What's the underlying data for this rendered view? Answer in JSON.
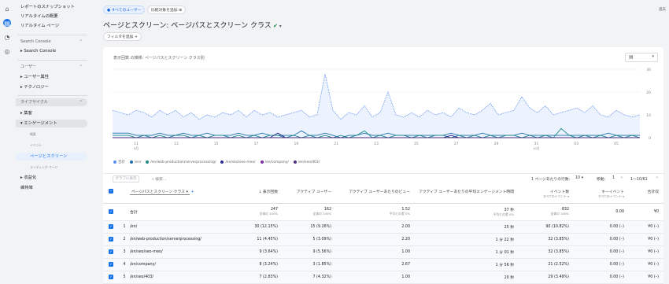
{
  "rail": {
    "icons": [
      "home-icon",
      "reports-icon",
      "explore-icon",
      "advertising-icon"
    ]
  },
  "sidebar": {
    "items": [
      {
        "label": "レポートのスナップショット"
      },
      {
        "label": "リアルタイムの概要"
      },
      {
        "label": "リアルタイム ページ"
      },
      {
        "label": "Search Console"
      },
      {
        "label": "Search Console"
      },
      {
        "label": "ユーザー"
      },
      {
        "label": "ユーザー属性"
      },
      {
        "label": "テクノロジー"
      },
      {
        "label": "ライフサイクル"
      },
      {
        "label": "集客"
      },
      {
        "label": "エンゲージメント"
      },
      {
        "label": "概要"
      },
      {
        "label": "イベント"
      },
      {
        "label": "ページとスクリーン"
      },
      {
        "label": "ランディング ページ"
      },
      {
        "label": "収益化"
      },
      {
        "label": "維持率"
      }
    ]
  },
  "header": {
    "segment_chip": "すべてのユーザー",
    "compare_chip": "比較対象を追加",
    "corner_text": "過去",
    "title": "ページとスクリーン: ページパスとスクリーン クラス",
    "filter_chip": "フィルタを追加"
  },
  "chart": {
    "title": "表示回数 の推移: ページパスとスクリーン クラス別",
    "dropdown_icon": "chart-type-icon",
    "colors": {
      "total": "#5b8def",
      "en": "#1e6fb0",
      "serverprocessing": "#1d8a8a",
      "seomeo": "#2e2a8c",
      "company": "#7a2e9f",
      "four03": "#4b2b7d"
    }
  },
  "chart_data": {
    "type": "line",
    "x_ticks": [
      "11",
      "13",
      "15",
      "17",
      "19",
      "21",
      "23",
      "25",
      "27",
      "29",
      "31",
      "03",
      "05"
    ],
    "x_sublabels": {
      "0": "9月",
      "10": "10\n月"
    },
    "ylim": [
      0,
      30
    ],
    "y_ticks": [
      0,
      10,
      20,
      30
    ],
    "series": [
      {
        "name": "合計",
        "values": [
          12,
          11,
          10,
          12,
          11,
          9,
          12,
          10,
          12,
          9,
          11,
          8,
          10,
          9,
          11,
          10,
          12,
          9,
          12,
          10,
          11,
          9,
          10,
          11,
          12,
          9,
          10,
          28,
          12,
          8,
          11,
          10,
          14,
          9,
          11,
          20,
          10,
          9,
          11,
          9,
          12,
          10,
          11,
          9,
          13,
          11,
          10,
          12,
          15,
          10,
          11,
          12,
          18,
          13,
          11,
          14,
          10,
          11,
          12,
          13,
          11,
          14,
          10,
          9,
          12,
          10,
          9,
          10
        ]
      },
      {
        "name": "/en/",
        "values": [
          2,
          2,
          2,
          1,
          1,
          1,
          2,
          1,
          1,
          2,
          1,
          1,
          2,
          1,
          1,
          1,
          2,
          1,
          1,
          2,
          1,
          1,
          1,
          1,
          3,
          1,
          1,
          2,
          1,
          0,
          1,
          1,
          2,
          1,
          1,
          2,
          1,
          1,
          1,
          1,
          1,
          1,
          1,
          2,
          1,
          1,
          1,
          2,
          1,
          1,
          1,
          1,
          2,
          1,
          1,
          1,
          1,
          1,
          1,
          1,
          1,
          1,
          1,
          2,
          1,
          1,
          1,
          1
        ]
      },
      {
        "name": "/en/web-production/serverprocessing/",
        "values": [
          1,
          1,
          1,
          0,
          1,
          0,
          1,
          0,
          1,
          1,
          0,
          1,
          0,
          1,
          1,
          0,
          1,
          0,
          1,
          0,
          1,
          1,
          0,
          1,
          0,
          1,
          0,
          1,
          0,
          1,
          0,
          1,
          3,
          0,
          1,
          0,
          1,
          1,
          0,
          1,
          0,
          1,
          1,
          0,
          1,
          0,
          1,
          0,
          1,
          0,
          1,
          1,
          0,
          1,
          0,
          1,
          0,
          4,
          1,
          0,
          1,
          0,
          1,
          0,
          1,
          0,
          1,
          0
        ]
      },
      {
        "name": "/en/seo/seo-meo/",
        "values": [
          0,
          0,
          0,
          0,
          0,
          0,
          0,
          0,
          0,
          0,
          0,
          0,
          0,
          0,
          0,
          0,
          0,
          0,
          0,
          0,
          0,
          2,
          0,
          0,
          0,
          0,
          0,
          0,
          0,
          0,
          0,
          0,
          0,
          0,
          0,
          0,
          0,
          0,
          0,
          0,
          0,
          0,
          0,
          1,
          0,
          0,
          0,
          0,
          0,
          0,
          0,
          0,
          0,
          0,
          0,
          0,
          0,
          0,
          0,
          0,
          0,
          0,
          0,
          0,
          0,
          0,
          0,
          0
        ]
      },
      {
        "name": "/en/company/",
        "values": [
          0,
          0,
          0,
          0,
          0,
          0,
          0,
          0,
          0,
          0,
          0,
          0,
          0,
          0,
          0,
          0,
          0,
          0,
          0,
          0,
          0,
          0,
          0,
          0,
          0,
          0,
          0,
          0,
          0,
          0,
          0,
          0,
          0,
          0,
          0,
          0,
          0,
          0,
          0,
          0,
          0,
          0,
          0,
          0,
          0,
          0,
          0,
          0,
          0,
          0,
          0,
          0,
          0,
          0,
          0,
          0,
          0,
          0,
          0,
          0,
          0,
          0,
          0,
          0,
          0,
          0,
          0,
          0
        ]
      },
      {
        "name": "/en/seo/403/",
        "values": [
          0,
          0,
          0,
          0,
          0,
          0,
          0,
          0,
          0,
          0,
          0,
          0,
          0,
          0,
          0,
          0,
          0,
          0,
          0,
          0,
          0,
          0,
          0,
          0,
          0,
          0,
          0,
          0,
          0,
          0,
          0,
          0,
          0,
          0,
          0,
          0,
          0,
          0,
          0,
          0,
          0,
          0,
          0,
          0,
          0,
          0,
          0,
          0,
          0,
          0,
          0,
          0,
          0,
          0,
          0,
          0,
          0,
          0,
          0,
          0,
          0,
          0,
          0,
          0,
          0,
          0,
          0,
          0
        ]
      }
    ]
  },
  "legend": [
    {
      "label": "合計",
      "color": "#5b8def"
    },
    {
      "label": "/en/",
      "color": "#1e6fb0"
    },
    {
      "label": "/en/web-production/serverprocessing/",
      "color": "#1d8a8a"
    },
    {
      "label": "/en/seo/seo-meo/",
      "color": "#2e2a8c"
    },
    {
      "label": "/en/company/",
      "color": "#7a2e9f"
    },
    {
      "label": "/en/seo/403/",
      "color": "#4b2b7d"
    }
  ],
  "toolbar": {
    "graph_button": "グラフに表示",
    "search_placeholder": "検索...",
    "rows_label": "1 ページあたりの行数:",
    "rows_value": "10",
    "goto_label": "移動:",
    "goto_value": "1",
    "range": "1～10/61"
  },
  "table": {
    "dimension": "ページパスとスクリーン クラス",
    "headers": [
      {
        "label": "↓ 表示回数",
        "sub": ""
      },
      {
        "label": "アクティブ ユーザー",
        "sub": ""
      },
      {
        "label": "アクティブ ユーザーあたりのビュー",
        "sub": ""
      },
      {
        "label": "アクティブ ユーザーあたりの平均エンゲージメント時間",
        "sub": ""
      },
      {
        "label": "イベント数",
        "sub": "すべてのイベント ▾"
      },
      {
        "label": "キーイベント",
        "sub": "すべてのイベント ▾"
      },
      {
        "label": "合計収",
        "sub": ""
      }
    ],
    "total": {
      "label": "合計",
      "cells": [
        {
          "v": "247",
          "s": "全体の 100%"
        },
        {
          "v": "162",
          "s": "全体の 100%"
        },
        {
          "v": "1.52",
          "s": "平均との差 0%"
        },
        {
          "v": "37 秒",
          "s": "平均との差 0%"
        },
        {
          "v": "832",
          "s": "全体の 100%"
        },
        {
          "v": "0.00",
          "s": ""
        },
        {
          "v": "¥0",
          "s": ""
        }
      ]
    },
    "rows": [
      {
        "n": "1",
        "page": "/en/",
        "cells": [
          "30 (12.15%)",
          "15 (9.26%)",
          "2.00",
          "25 秒",
          "90 (10.82%)",
          "0.00 (–)",
          "¥0 (–)"
        ]
      },
      {
        "n": "2",
        "page": "/en/web-production/serverprocessing/",
        "cells": [
          "11 (4.45%)",
          "5 (3.09%)",
          "2.20",
          "1 分 22 秒",
          "32 (3.85%)",
          "0.00 (–)",
          "¥0 (–)"
        ]
      },
      {
        "n": "3",
        "page": "/en/seo/seo-meo/",
        "cells": [
          "9 (3.64%)",
          "9 (5.56%)",
          "1.00",
          "1 分 01 秒",
          "32 (3.85%)",
          "0.00 (–)",
          "¥0 (–)"
        ]
      },
      {
        "n": "4",
        "page": "/en/company/",
        "cells": [
          "8 (3.24%)",
          "3 (1.85%)",
          "2.67",
          "1 分 56 秒",
          "21 (2.52%)",
          "0.00 (–)",
          "¥0 (–)"
        ]
      },
      {
        "n": "5",
        "page": "/en/seo/403/",
        "cells": [
          "7 (2.83%)",
          "7 (4.32%)",
          "1.00",
          "20 秒",
          "29 (3.49%)",
          "0.00 (–)",
          "¥0 (–)"
        ]
      }
    ]
  }
}
